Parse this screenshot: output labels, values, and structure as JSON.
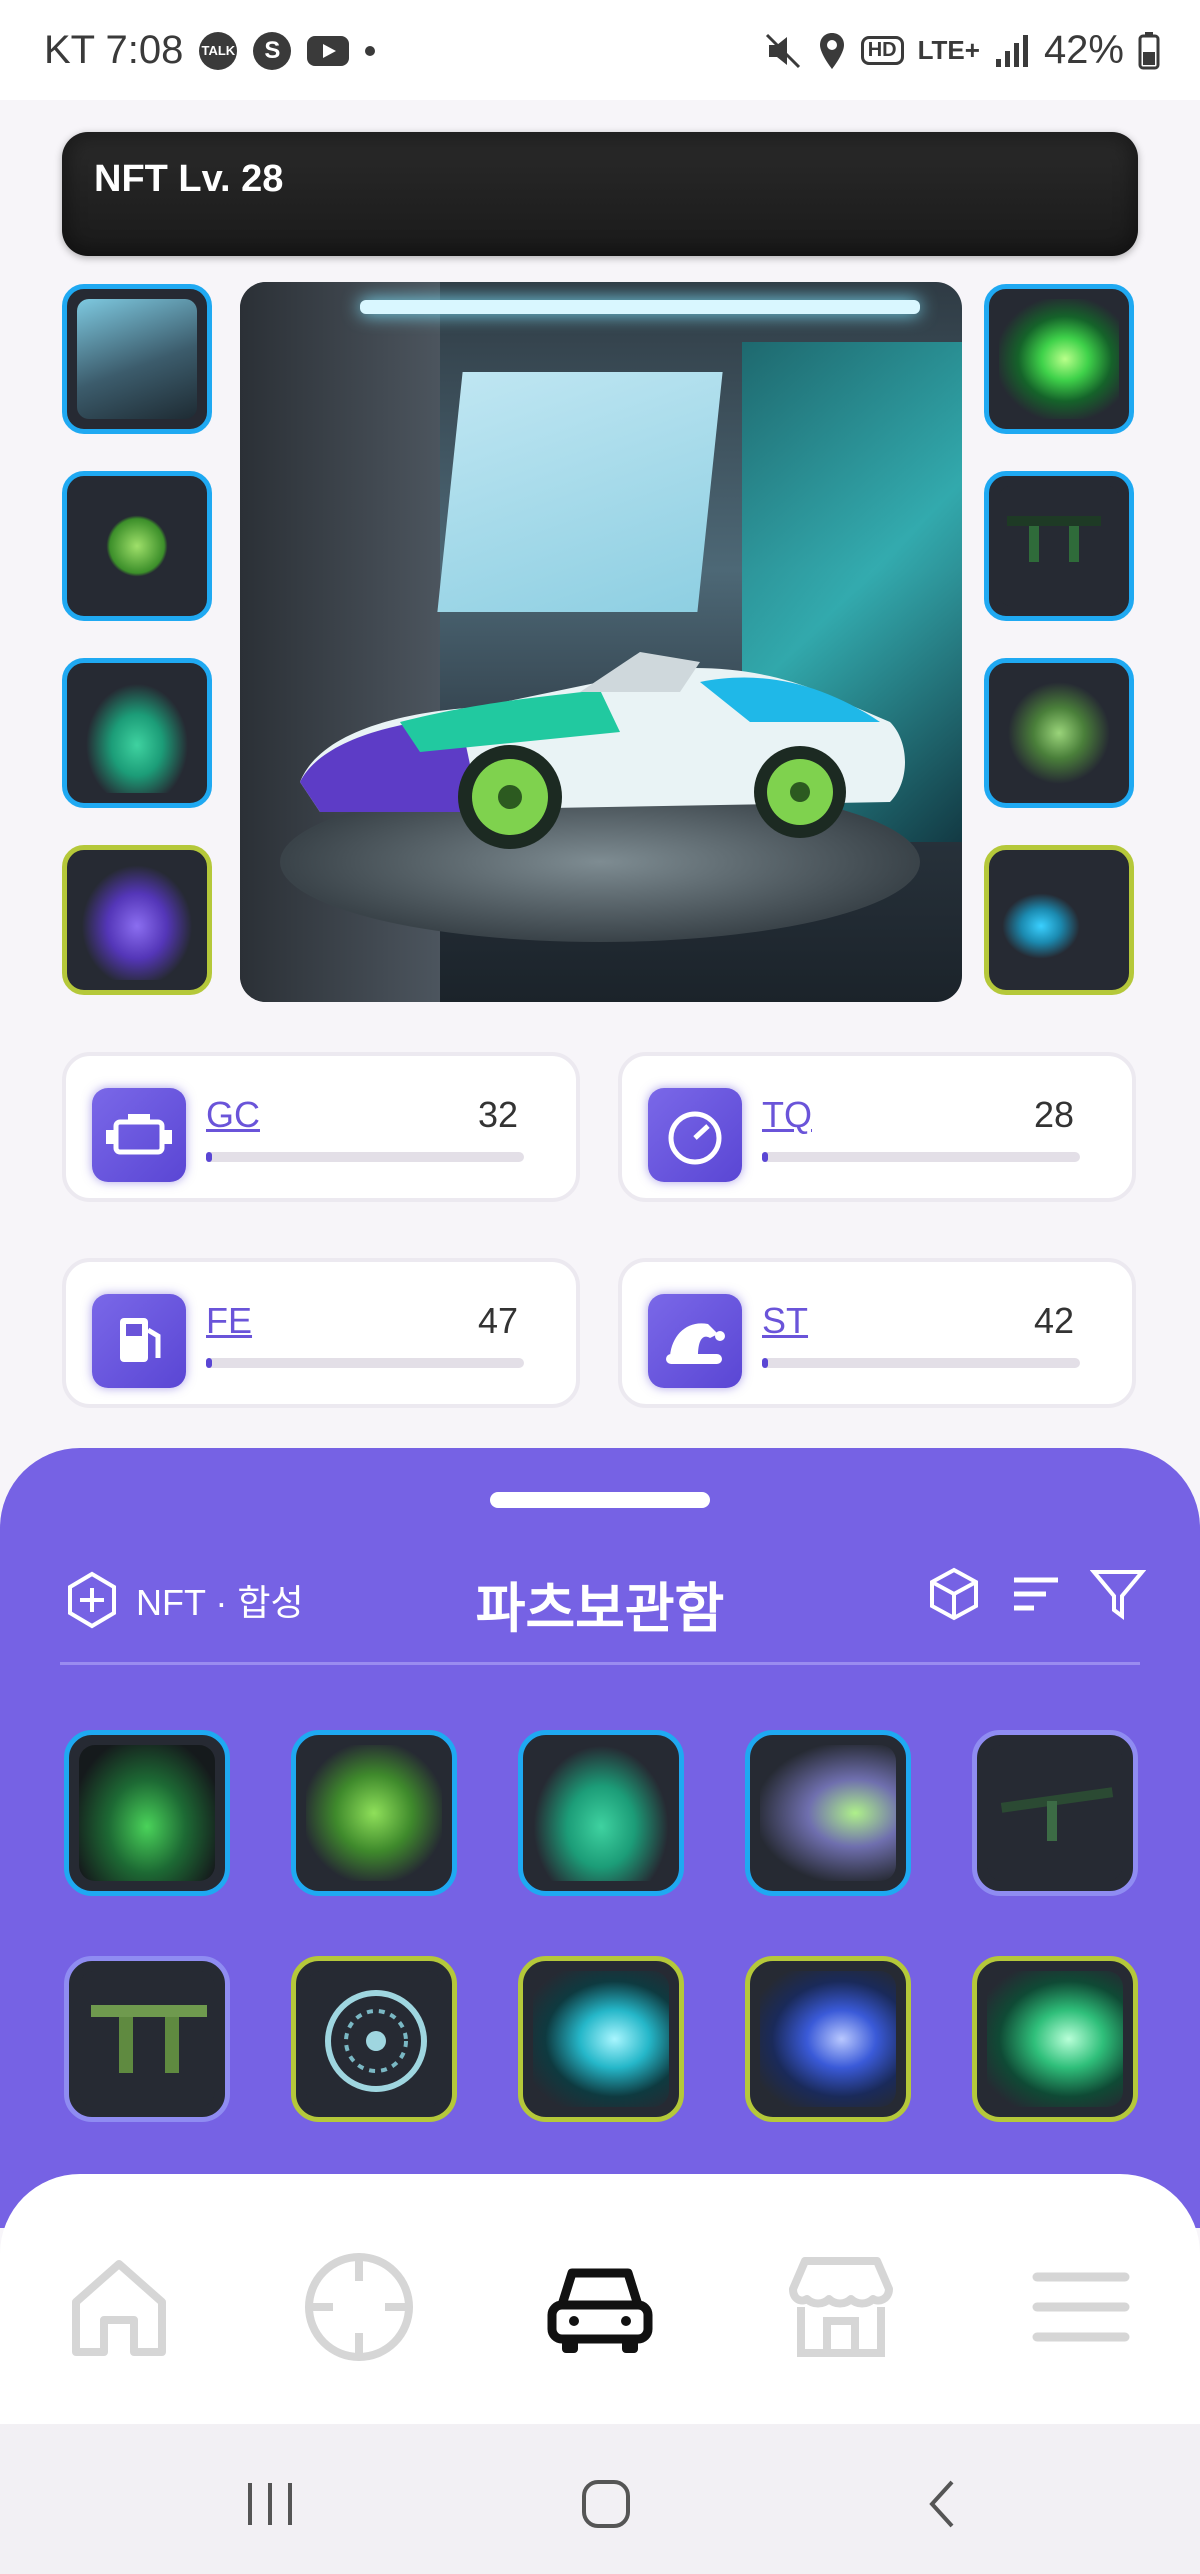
{
  "status_bar": {
    "carrier_time": "KT 7:08",
    "talk_badge": "TALK",
    "s_badge": "S",
    "hd_badge": "HD",
    "network": "LTE+",
    "battery": "42%"
  },
  "level": {
    "text": "NFT Lv. 28"
  },
  "equipped_parts": {
    "left": [
      {
        "name": "garage-background-part",
        "frame": "blue"
      },
      {
        "name": "wheel-part",
        "frame": "blue"
      },
      {
        "name": "car-body-part",
        "frame": "blue"
      },
      {
        "name": "front-bumper-part",
        "frame": "lime"
      }
    ],
    "right": [
      {
        "name": "boost-effect-part",
        "frame": "blue"
      },
      {
        "name": "spoiler-part",
        "frame": "blue"
      },
      {
        "name": "engine-part",
        "frame": "blue"
      },
      {
        "name": "side-mirror-part",
        "frame": "lime"
      }
    ]
  },
  "stats": [
    {
      "label": "GC",
      "value": "32",
      "icon": "engine-icon",
      "level": 0.02
    },
    {
      "label": "TQ",
      "value": "28",
      "icon": "speedometer-icon",
      "level": 0.02
    },
    {
      "label": "FE",
      "value": "47",
      "icon": "fuel-icon",
      "level": 0.02
    },
    {
      "label": "ST",
      "value": "42",
      "icon": "hat-icon",
      "level": 0.02
    }
  ],
  "sheet": {
    "merge_label": "NFT · 합성",
    "title": "파츠보관함",
    "tool_icons": [
      "cube-icon",
      "sort-icon",
      "filter-icon"
    ]
  },
  "inventory": [
    {
      "part": "garage-background",
      "frame": "blue"
    },
    {
      "part": "front-bumper",
      "frame": "blue"
    },
    {
      "part": "car-body",
      "frame": "blue"
    },
    {
      "part": "boost-effect",
      "frame": "blue"
    },
    {
      "part": "spoiler",
      "frame": "violet"
    },
    {
      "part": "spoiler-mount",
      "frame": "violet"
    },
    {
      "part": "wheel",
      "frame": "lime"
    },
    {
      "part": "boost-effect-cyan",
      "frame": "lime"
    },
    {
      "part": "boost-effect-blue",
      "frame": "lime"
    },
    {
      "part": "boost-effect-green",
      "frame": "lime"
    }
  ],
  "tabs": [
    {
      "name": "home-icon",
      "active": false
    },
    {
      "name": "crosshair-icon",
      "active": false
    },
    {
      "name": "car-icon",
      "active": true
    },
    {
      "name": "store-icon",
      "active": false
    },
    {
      "name": "menu-icon",
      "active": false
    }
  ],
  "colors": {
    "accent": "#7662e4",
    "frame_blue": "#1fa9f2",
    "frame_lime": "#b5c83a",
    "frame_violet": "#8f8cf2",
    "stat_bar": "#5a46d4"
  }
}
